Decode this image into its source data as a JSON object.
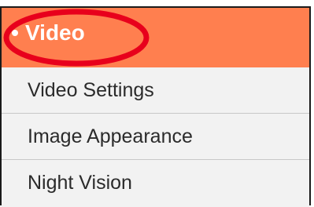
{
  "menu": {
    "header": {
      "label": "Video",
      "bullet": "•"
    },
    "items": [
      {
        "label": "Video Settings"
      },
      {
        "label": "Image Appearance"
      },
      {
        "label": "Night Vision"
      }
    ]
  },
  "colors": {
    "header_background": "#ff7f4f",
    "highlight_ring": "#e8001c",
    "item_background": "#f2f2f2"
  }
}
